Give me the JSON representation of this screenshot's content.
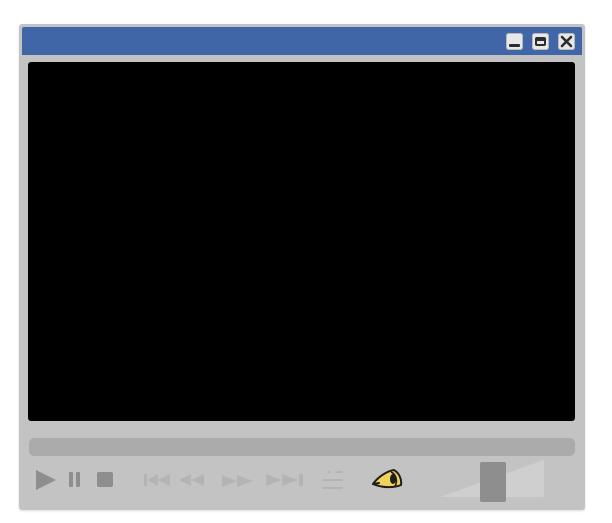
{
  "window": {
    "controls": {
      "minimize_icon": "minimize-icon",
      "maximize_icon": "maximize-icon",
      "close_icon": "close-icon"
    }
  },
  "video": {
    "content": ""
  },
  "seekbar": {
    "progress": 0
  },
  "controls": {
    "icons": [
      "play-icon",
      "pause-icon",
      "stop-icon",
      "skip-previous-icon",
      "rewind-icon",
      "fast-forward-icon",
      "skip-next-icon",
      "playlist-icon",
      "eye-icon"
    ],
    "enabled": {
      "play": true,
      "pause": true,
      "stop": true,
      "skip_previous": false,
      "rewind": false,
      "fast_forward": false,
      "skip_next": false,
      "playlist": false,
      "eye": true
    }
  },
  "volume": {
    "level": 0.5
  },
  "colors": {
    "titlebar": "#4166a8",
    "frame": "#c3c3c3",
    "screen": "#000000",
    "control_active": "#8e8e8e",
    "control_disabled": "#b4b4b4",
    "eye_accent": "#f1d35c"
  }
}
